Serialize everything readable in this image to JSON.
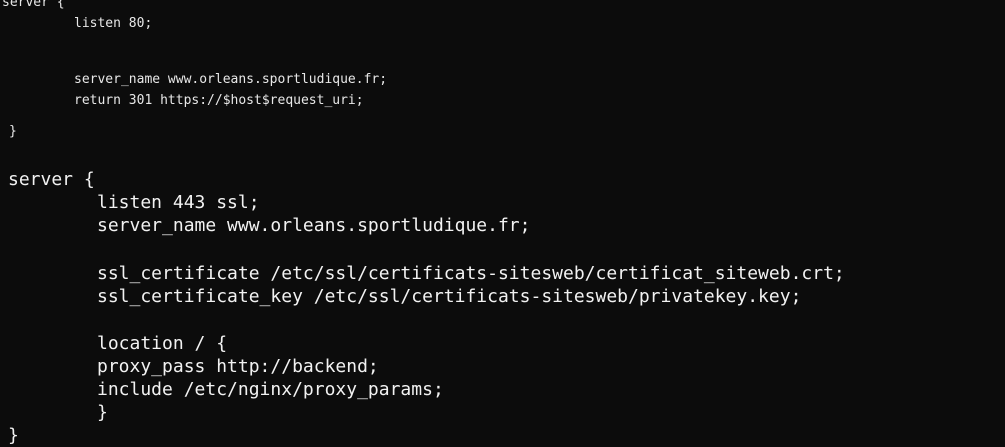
{
  "terminal": {
    "lines": [
      "server {",
      "listen 80;",
      "server_name www.orleans.sportludique.fr;",
      "return 301 https://$host$request_uri;",
      "}",
      "server {",
      "listen 443 ssl;",
      "server_name www.orleans.sportludique.fr;",
      "ssl_certificate /etc/ssl/certificats-sitesweb/certificat_siteweb.crt;",
      "ssl_certificate_key /etc/ssl/certificats-sitesweb/privatekey.key;",
      "location / {",
      "proxy_pass http://backend;",
      "include /etc/nginx/proxy_params;",
      "}",
      "}"
    ]
  }
}
